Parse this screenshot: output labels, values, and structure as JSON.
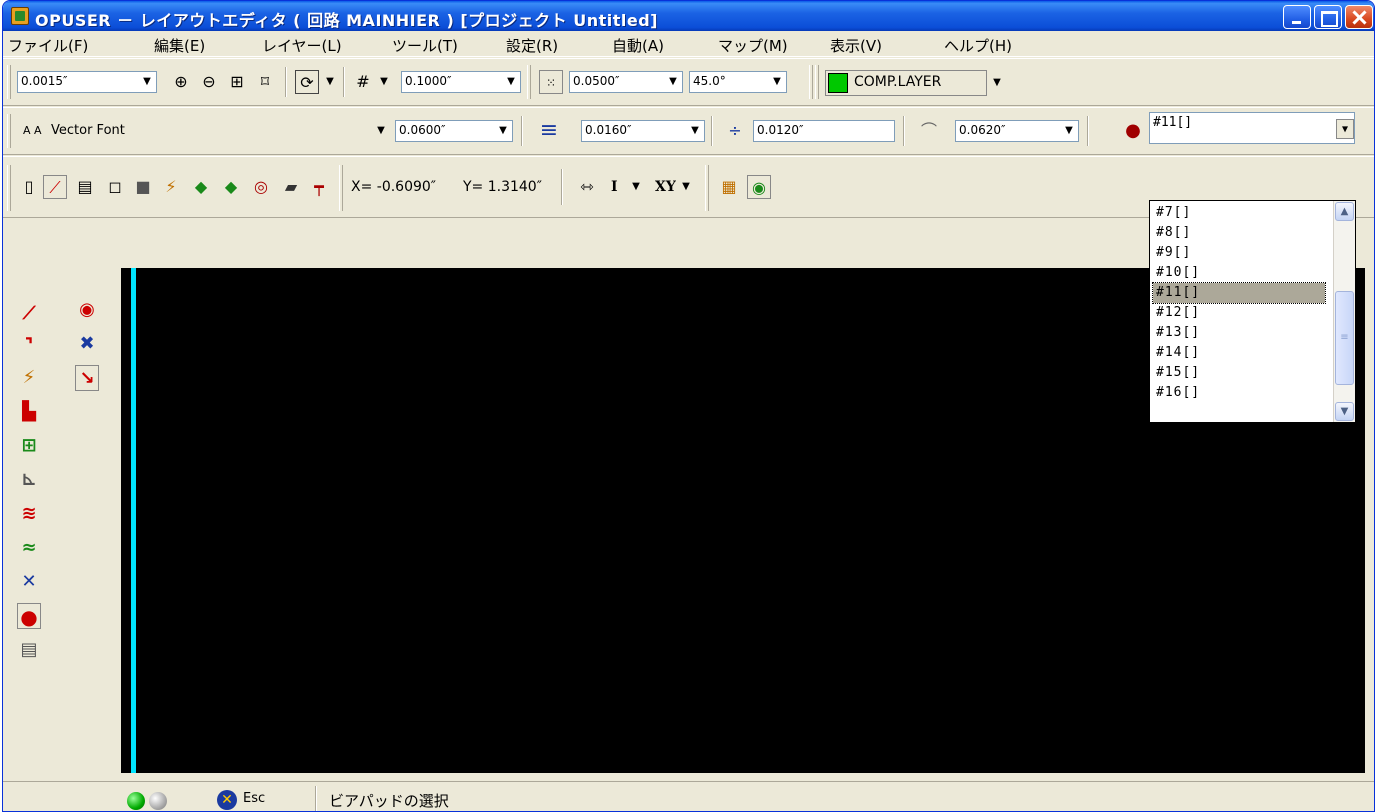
{
  "window": {
    "title": "OPUSER － レイアウトエディタ ( 回路 MAINHIER ) [プロジェクト Untitled]"
  },
  "menu": {
    "items": [
      "ファイル(F)",
      "編集(E)",
      "レイヤー(L)",
      "ツール(T)",
      "設定(R)",
      "自動(A)",
      "マップ(M)",
      "表示(V)",
      "ヘルプ(H)"
    ]
  },
  "toolbar1": {
    "zoom_value": "0.0015″",
    "grid_value": "0.1000″",
    "snap_value": "0.0500″",
    "angle_value": "45.0°",
    "layer_name": "COMP.LAYER",
    "layer_color": "#00c800"
  },
  "toolbar2": {
    "font_label": "Vector Font",
    "text_height": "0.0600″",
    "line_width": "0.0160″",
    "clearance": "0.0120″",
    "arc_value": "0.0620″",
    "via_layer": "#11[]"
  },
  "toolbar3": {
    "x_coord": "X= -0.6090″",
    "y_coord": "Y= 1.3140″",
    "i_label": "I",
    "xy_label": "XY"
  },
  "dropdown": {
    "items": [
      "#7[]",
      "#8[]",
      "#9[]",
      "#10[]",
      "#11[]",
      "#12[]",
      "#13[]",
      "#14[]",
      "#15[]",
      "#16[]"
    ],
    "selected": "#11[]"
  },
  "status": {
    "esc_label": "Esc",
    "message": "ビアパッドの選択"
  },
  "colors": {
    "canvas_background": "#000000",
    "canvas_line": "#00e5ff"
  }
}
